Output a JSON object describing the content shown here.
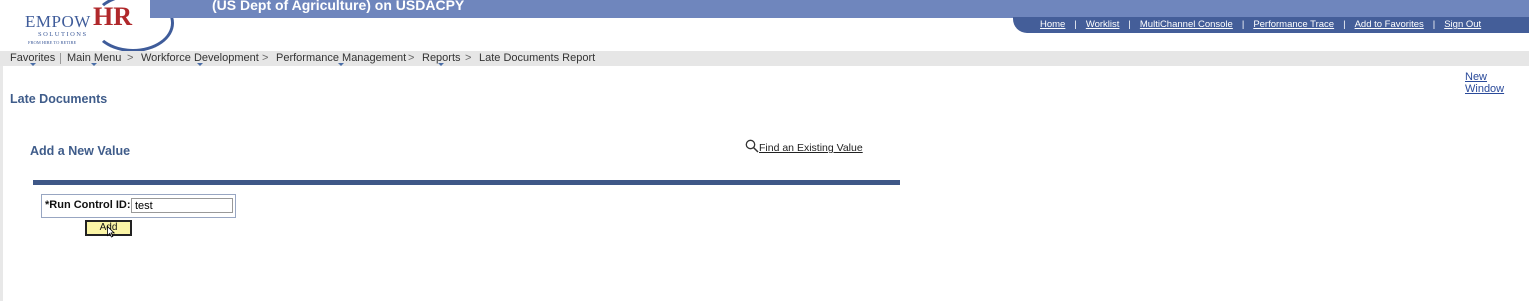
{
  "header": {
    "logo": {
      "main": "EMPOW",
      "accent": "HR",
      "sub": "SOLUTIONS",
      "tagline": "FROM HIRE TO RETIRE"
    },
    "banner_title": "(US Dept of Agriculture) on USDACPY",
    "nav_links": [
      "Home",
      "Worklist",
      "MultiChannel Console",
      "Performance Trace",
      "Add to Favorites",
      "Sign Out"
    ],
    "colors": {
      "banner": "#6f86bd",
      "navbar": "#445e99"
    }
  },
  "breadcrumb": {
    "items": [
      "Favorites",
      "Main Menu",
      "Workforce Development",
      "Performance Management",
      "Reports",
      "Late Documents Report"
    ],
    "separator": ">"
  },
  "new_window": "New Window",
  "page_title": "Late Documents",
  "section": {
    "title": "Add a New Value",
    "find_existing": "Find an Existing Value"
  },
  "form": {
    "run_control_label": "*Run Control ID:",
    "run_control_value": "test",
    "add_button": "Add"
  }
}
